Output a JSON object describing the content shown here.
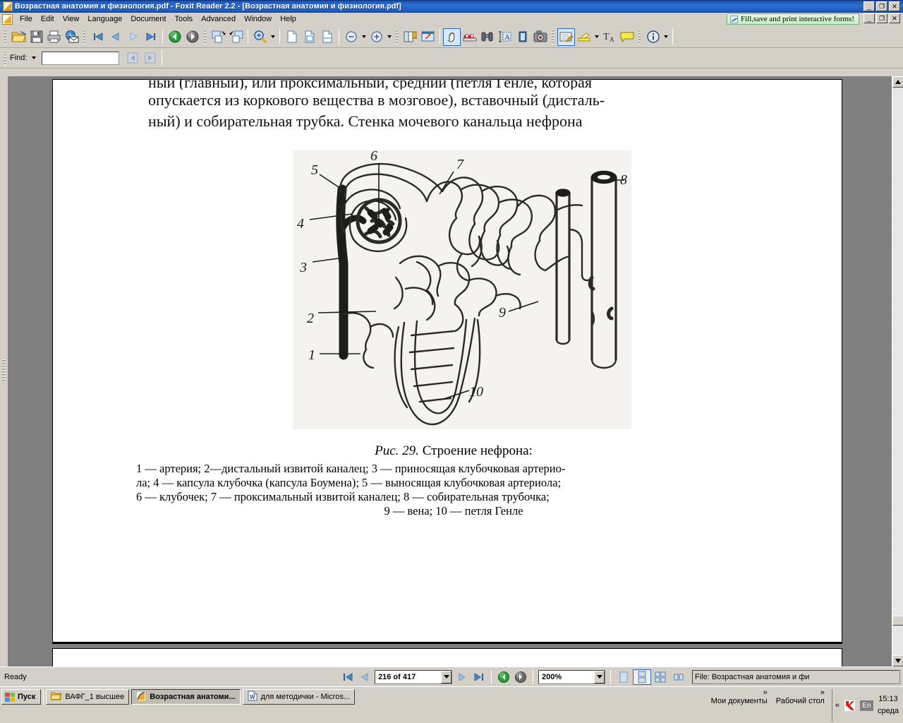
{
  "window": {
    "title": "Возрастная анатомия и физиология.pdf - Foxit Reader 2.2 - [Возрастная анатомия и физиология.pdf]",
    "minimize": "_",
    "maximize": "❐",
    "close": "✕",
    "banner": "Fill,save and print interactive forms!"
  },
  "menu": {
    "items": [
      {
        "label": "File"
      },
      {
        "label": "Edit"
      },
      {
        "label": "View"
      },
      {
        "label": "Language"
      },
      {
        "label": "Document"
      },
      {
        "label": "Tools"
      },
      {
        "label": "Advanced"
      },
      {
        "label": "Window"
      },
      {
        "label": "Help"
      }
    ]
  },
  "toolbar": {
    "buttons": [
      {
        "name": "open-icon"
      },
      {
        "name": "save-icon"
      },
      {
        "name": "print-icon"
      },
      {
        "name": "email-icon"
      },
      {
        "name": "first-page-icon"
      },
      {
        "name": "previous-page-icon"
      },
      {
        "name": "next-page-icon"
      },
      {
        "name": "last-page-icon"
      },
      {
        "name": "go-back-icon"
      },
      {
        "name": "go-forward-icon"
      },
      {
        "name": "rotate-clockwise-icon"
      },
      {
        "name": "rotate-counterclockwise-icon"
      },
      {
        "name": "zoom-in-tool-icon"
      },
      {
        "name": "actual-size-icon"
      },
      {
        "name": "fit-page-icon"
      },
      {
        "name": "fit-width-icon"
      },
      {
        "name": "zoom-out-icon"
      },
      {
        "name": "zoom-in-icon"
      },
      {
        "name": "bookmarks-icon"
      },
      {
        "name": "full-screen-icon"
      },
      {
        "name": "hand-tool-icon"
      },
      {
        "name": "snapshot-read-icon"
      },
      {
        "name": "find-binoculars-icon"
      },
      {
        "name": "select-text-icon"
      },
      {
        "name": "select-image-icon"
      },
      {
        "name": "snapshot-icon"
      },
      {
        "name": "typewriter-icon"
      },
      {
        "name": "highlight-icon"
      },
      {
        "name": "text-style-icon"
      },
      {
        "name": "note-icon"
      },
      {
        "name": "about-info-icon"
      }
    ]
  },
  "findbar": {
    "label": "Find:",
    "value": "",
    "placeholder": "",
    "prev": "find-previous-icon",
    "next": "find-next-icon"
  },
  "document": {
    "body_lines": [
      "ный (главный), или проксимальный, средний (петля Генле, которая",
      "опускается из коркового вещества в мозговое), вставочный (дисталь-",
      "ный) и собирательная трубка. Стенка мочевого канальца нефрона"
    ],
    "figure": {
      "title_prefix": "Рис. 29.",
      "title_text": "Строение нефрона:",
      "legend_lines": [
        "1 — артерия; 2—дистальный извитой каналец; 3 — приносящая клубочковая артерио-",
        "ла; 4 — капсула клубочка (капсула Боумена); 5 — выносящая клубочковая артериола;",
        "6 — клубочек; 7 — проксимальный извитой каналец; 8 — собирательная трубочка;",
        "9 — вена; 10 — петля Генле"
      ],
      "callouts": [
        "1",
        "2",
        "3",
        "4",
        "5",
        "6",
        "7",
        "8",
        "9",
        "10"
      ]
    }
  },
  "statusbar": {
    "ready": "Ready",
    "page_value": "216 of 417",
    "zoom_value": "200%",
    "file_label": "File: Возрастная анатомия и фи",
    "first_page": "first-page-icon",
    "prev_page": "previous-page-icon",
    "next_page": "next-page-icon",
    "last_page": "last-page-icon",
    "back": "go-back-icon",
    "forward": "go-forward-icon",
    "views": [
      "single-page-view-icon",
      "continuous-view-icon",
      "facing-view-icon",
      "continuous-facing-view-icon"
    ]
  },
  "taskbar": {
    "start": "Пуск",
    "items": [
      {
        "label": "ВАФГ_1 высшее",
        "icon": "folder-icon",
        "active": false
      },
      {
        "label": "Возрастная анатоми...",
        "icon": "foxit-icon",
        "active": true
      },
      {
        "label": "для методички - Micros...",
        "icon": "word-icon",
        "active": false
      }
    ],
    "deskbands": [
      {
        "label": "Мои документы",
        "chevron": "»"
      },
      {
        "label": "Рабочий стол",
        "chevron": "»"
      }
    ],
    "tray_collapse": "«",
    "tray_icon": "kaspersky-icon",
    "language": "En",
    "clock_time": "15:13",
    "clock_day": "среда"
  },
  "colors": {
    "titlebar_blue": "#0a246a",
    "face": "#d4d0c8",
    "banner_green": "#c6eec6",
    "doc_bg": "#808080",
    "page_white": "#ffffff"
  }
}
